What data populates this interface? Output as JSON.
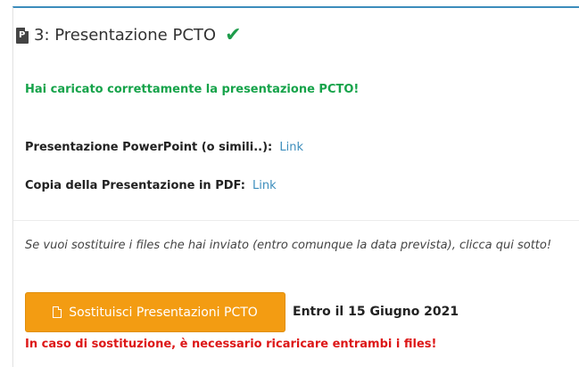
{
  "section": {
    "title": "3: Presentazione PCTO",
    "icon": "file-powerpoint-icon",
    "status_icon": "check-icon",
    "status_color": "#1e9c4b"
  },
  "success_message": "Hai caricato correttamente la presentazione PCTO!",
  "files": [
    {
      "label": "Presentazione PowerPoint (o simili..):",
      "link_text": "Link"
    },
    {
      "label": "Copia della Presentazione in PDF:",
      "link_text": "Link"
    }
  ],
  "note": "Se vuoi sostituire i files che hai inviato (entro comunque la data prevista), clicca qui sotto!",
  "replace_button": {
    "label": "Sostituisci Presentazioni PCTO",
    "icon": "file-pdf-icon",
    "color": "#f39c12"
  },
  "deadline": "Entro il 15 Giugno 2021",
  "warning": "In caso di sostituzione, è necessario ricaricare entrambi i files!",
  "colors": {
    "accent": "#3c8dbc",
    "success": "#16a34a",
    "danger": "#dd1717"
  }
}
